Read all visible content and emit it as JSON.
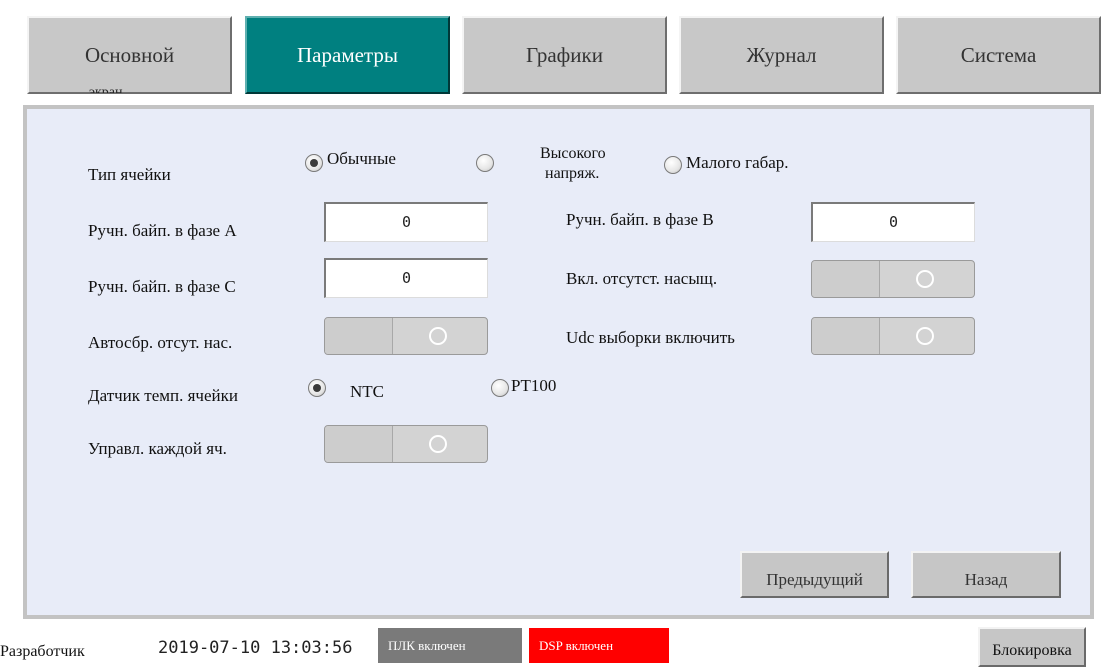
{
  "tabs": [
    {
      "label": "Основной",
      "sub_label": "экран",
      "active": false
    },
    {
      "label": "Параметры",
      "active": true
    },
    {
      "label": "Графики",
      "active": false
    },
    {
      "label": "Журнал",
      "active": false
    },
    {
      "label": "Система",
      "active": false
    }
  ],
  "params": {
    "cell_type": {
      "label": "Тип ячейки",
      "options": [
        "Обычные",
        "Высокого",
        "напряж.",
        "Малого габар."
      ],
      "selected": "Обычные"
    },
    "bypass_a": {
      "label": "Ручн. байп. в фазе A",
      "value": "0"
    },
    "bypass_b": {
      "label": "Ручн. байп. в фазе B",
      "value": "0"
    },
    "bypass_c": {
      "label": "Ручн. байп. в фазе C",
      "value": "0"
    },
    "sat_enable": {
      "label": "Вкл. отсутст. насыщ.",
      "on": false
    },
    "auto_reset": {
      "label": "Автосбр. отсут. нас.",
      "on": false
    },
    "udc_sampling": {
      "label": "Udc выборки включить",
      "on": false
    },
    "temp_sensor": {
      "label": "Датчик темп. ячейки",
      "options": [
        "NTC",
        "PT100"
      ],
      "selected": "NTC"
    },
    "per_cell": {
      "label": "Управл. каждой яч.",
      "on": false
    }
  },
  "buttons": {
    "prev": "Предыдущий",
    "back": "Назад"
  },
  "status": {
    "developer_label": "Разработчик",
    "datetime": "2019-07-10 13:03:56",
    "plc_badge": "ПЛК включен",
    "dsp_badge": "DSP включен",
    "lock_button": "Блокировка"
  },
  "colors": {
    "active_tab": "#008080",
    "panel_bg": "#e8ecf8",
    "plc_badge": "#7a7a7a",
    "dsp_badge": "#ff0000"
  }
}
